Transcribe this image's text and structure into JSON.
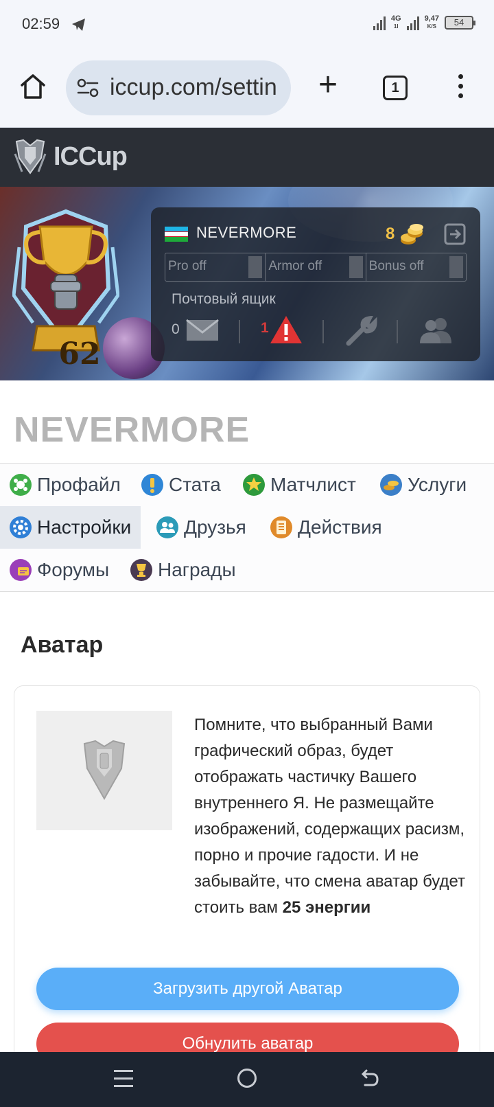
{
  "status_bar": {
    "time": "02:59",
    "network": "4G",
    "network_sub": "1l",
    "speed_value": "9,47",
    "speed_unit": "K/S",
    "battery": "54"
  },
  "browser": {
    "url": "iccup.com/settin",
    "tab_count": "1"
  },
  "site": {
    "logo_text": "ICCup"
  },
  "user_panel": {
    "level": "62",
    "username": "NEVERMORE",
    "coins": "8",
    "toggles": [
      "Pro off",
      "Armor off",
      "Bonus off"
    ],
    "mailbox_label": "Почтовый ящик",
    "mail_count": "0",
    "warning_count": "1"
  },
  "page_title": "NEVERMORE",
  "nav": {
    "items": [
      {
        "label": "Профайл",
        "icon": "profile-icon",
        "color": "#3fae49"
      },
      {
        "label": "Стата",
        "icon": "stats-icon",
        "color": "#2f86d6"
      },
      {
        "label": "Матчлист",
        "icon": "matchlist-icon",
        "color": "#2e9a3c"
      },
      {
        "label": "Услуги",
        "icon": "services-icon",
        "color": "#e0a02a"
      },
      {
        "label": "Настройки",
        "icon": "settings-icon",
        "color": "#2f7fd6"
      },
      {
        "label": "Друзья",
        "icon": "friends-icon",
        "color": "#2c9bb8"
      },
      {
        "label": "Действия",
        "icon": "actions-icon",
        "color": "#e08a2a"
      },
      {
        "label": "Форумы",
        "icon": "forums-icon",
        "color": "#9a3fb8"
      },
      {
        "label": "Награды",
        "icon": "awards-icon",
        "color": "#6a4a2a"
      }
    ],
    "active": "Настройки"
  },
  "avatar_section": {
    "title": "Аватар",
    "text": "Помните, что выбранный Вами графический образ, будет отображать частичку Вашего внутреннего Я. Не размещайте изображений, содержащих расизм, порно и прочие гадости. И не забывайте, что смена аватар будет стоить вам",
    "cost": "25 энергии",
    "upload_button": "Загрузить другой Аватар",
    "reset_button": "Обнулить аватар"
  },
  "colors": {
    "upload_button": "#5aaef8",
    "reset_button": "#e4514d",
    "header_bg": "#2b2f36"
  }
}
